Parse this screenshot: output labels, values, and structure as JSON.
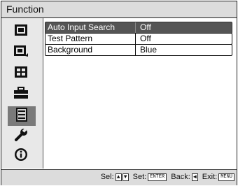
{
  "title": "Function",
  "sidebar": {
    "items": [
      {
        "icon": "picture-icon"
      },
      {
        "icon": "picture-advanced-icon"
      },
      {
        "icon": "screen-icon"
      },
      {
        "icon": "setup-icon"
      },
      {
        "icon": "function-icon",
        "active": true
      },
      {
        "icon": "installation-wrench-icon"
      },
      {
        "icon": "information-icon"
      }
    ]
  },
  "settings": [
    {
      "label": "Auto Input Search",
      "value": "Off",
      "selected": true
    },
    {
      "label": "Test Pattern",
      "value": "Off"
    },
    {
      "label": "Background",
      "value": "Blue"
    }
  ],
  "status": {
    "sel": "Sel:",
    "up_key": "▲",
    "down_key": "▼",
    "set": "Set:",
    "enter_key": "ENTER",
    "back": "Back:",
    "back_key": "◀",
    "exit": "Exit:",
    "menu_key": "MENU"
  }
}
